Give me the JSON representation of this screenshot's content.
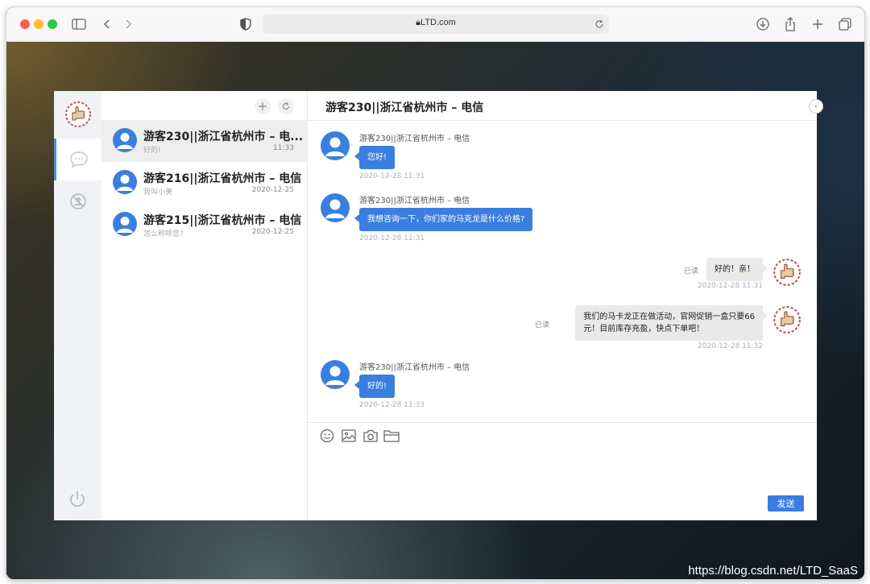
{
  "browser": {
    "url": "LTD.com",
    "traffic_colors": [
      "#fe5f57",
      "#febc2e",
      "#28c840"
    ]
  },
  "watermark": "https://blog.csdn.net/LTD_SaaS",
  "sidebar": {
    "tabs": [
      {
        "icon": "chat-bubble-icon",
        "active": true
      },
      {
        "icon": "blocked-user-icon",
        "active": false
      }
    ],
    "logout_icon": "power-icon"
  },
  "conversation_list": {
    "items": [
      {
        "name": "游客230||浙江省杭州市 – 电...",
        "preview": "好的!",
        "time": "11:33",
        "selected": true
      },
      {
        "name": "游客216||浙江省杭州市 – 电信",
        "preview": "我叫小美",
        "time": "2020-12-25",
        "selected": false
      },
      {
        "name": "游客215||浙江省杭州市 – 电信",
        "preview": "怎么称呼您?",
        "time": "2020-12-25",
        "selected": false
      }
    ]
  },
  "chat": {
    "title": "游客230||浙江省杭州市 – 电信",
    "messages": [
      {
        "direction": "in",
        "sender": "游客230||浙江省杭州市 – 电信",
        "text": "您好!",
        "time": "2020-12-28 11:31"
      },
      {
        "direction": "in",
        "sender": "游客230||浙江省杭州市 – 电信",
        "text": "我想咨询一下，你们家的马克龙是什么价格?",
        "time": "2020-12-28 11:31"
      },
      {
        "direction": "out",
        "status": "已读",
        "text": "好的！亲！",
        "time": "2020-12-28 11:31"
      },
      {
        "direction": "out",
        "status": "已读",
        "text_line1": "我们的马卡龙正在做活动，官网促销一盒只要66",
        "text_line2": "元！目前库存充盈，快点下单吧！",
        "time": "2020-12-28 11:32"
      },
      {
        "direction": "in",
        "sender": "游客230||浙江省杭州市 – 电信",
        "text": "好的!",
        "time": "2020-12-28 11:33"
      }
    ]
  },
  "composer": {
    "tools": [
      "emoji-icon",
      "image-icon",
      "camera-icon",
      "folder-icon"
    ],
    "send_label": "发送"
  },
  "colors": {
    "accent": "#3a7fe0",
    "incoming_bubble": "#3a7fe0",
    "outgoing_bubble": "#e9e9e9"
  }
}
